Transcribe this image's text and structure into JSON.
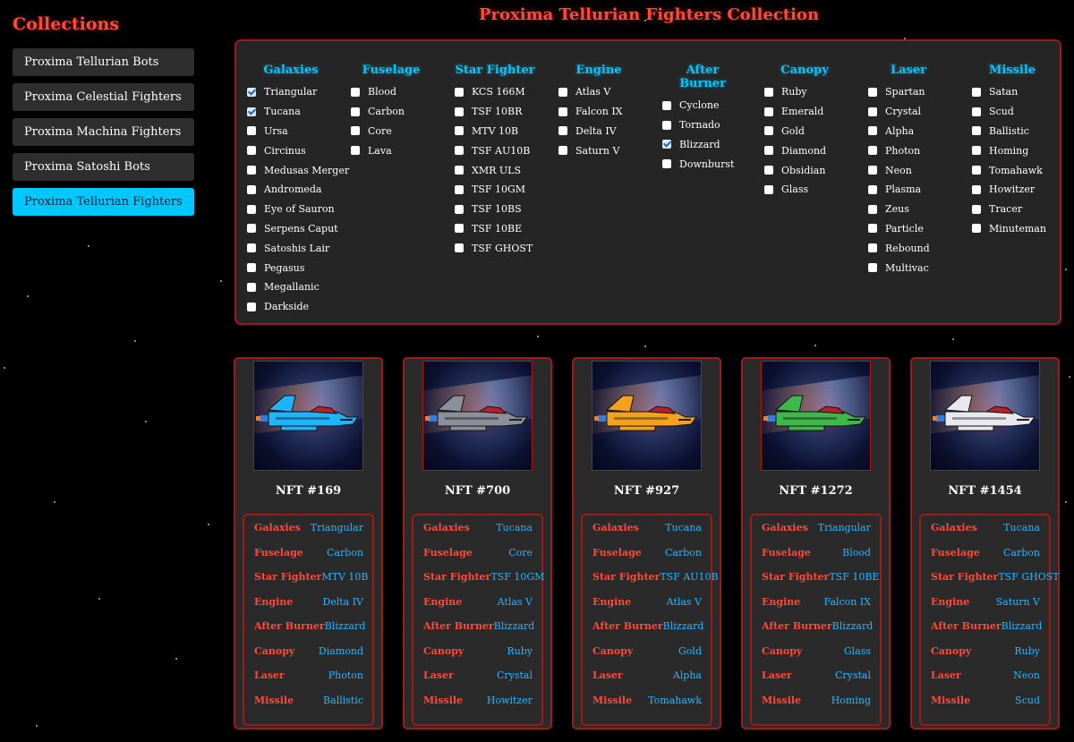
{
  "sidebar": {
    "heading": "Collections",
    "items": [
      {
        "label": "Proxima Tellurian Bots"
      },
      {
        "label": "Proxima Celestial Fighters"
      },
      {
        "label": "Proxima Machina Fighters"
      },
      {
        "label": "Proxima Satoshi Bots"
      },
      {
        "label": "Proxima Tellurian Fighters",
        "active": true
      }
    ]
  },
  "title": "Proxima Tellurian Fighters Collection",
  "filters": [
    {
      "name": "Galaxies",
      "options": [
        {
          "label": "Triangular",
          "checked": true
        },
        {
          "label": "Tucana",
          "checked": true
        },
        {
          "label": "Ursa"
        },
        {
          "label": "Circinus"
        },
        {
          "label": "Medusas Merger"
        },
        {
          "label": "Andromeda"
        },
        {
          "label": "Eye of Sauron"
        },
        {
          "label": "Serpens Caput"
        },
        {
          "label": "Satoshis Lair"
        },
        {
          "label": "Pegasus"
        },
        {
          "label": "Megallanic"
        },
        {
          "label": "Darkside"
        }
      ]
    },
    {
      "name": "Fuselage",
      "options": [
        {
          "label": "Blood"
        },
        {
          "label": "Carbon"
        },
        {
          "label": "Core"
        },
        {
          "label": "Lava"
        }
      ]
    },
    {
      "name": "Star Fighter",
      "options": [
        {
          "label": "KCS 166M"
        },
        {
          "label": "TSF 10BR"
        },
        {
          "label": "MTV 10B"
        },
        {
          "label": "TSF AU10B"
        },
        {
          "label": "XMR ULS"
        },
        {
          "label": "TSF 10GM"
        },
        {
          "label": "TSF 10BS"
        },
        {
          "label": "TSF 10BE"
        },
        {
          "label": "TSF GHOST"
        }
      ]
    },
    {
      "name": "Engine",
      "options": [
        {
          "label": "Atlas V"
        },
        {
          "label": "Falcon IX"
        },
        {
          "label": "Delta IV"
        },
        {
          "label": "Saturn V"
        }
      ]
    },
    {
      "name": "After Burner",
      "options": [
        {
          "label": "Cyclone"
        },
        {
          "label": "Tornado"
        },
        {
          "label": "Blizzard",
          "checked": true
        },
        {
          "label": "Downburst"
        }
      ]
    },
    {
      "name": "Canopy",
      "options": [
        {
          "label": "Ruby"
        },
        {
          "label": "Emerald"
        },
        {
          "label": "Gold"
        },
        {
          "label": "Diamond"
        },
        {
          "label": "Obsidian"
        },
        {
          "label": "Glass"
        }
      ]
    },
    {
      "name": "Laser",
      "options": [
        {
          "label": "Spartan"
        },
        {
          "label": "Crystal"
        },
        {
          "label": "Alpha"
        },
        {
          "label": "Photon"
        },
        {
          "label": "Neon"
        },
        {
          "label": "Plasma"
        },
        {
          "label": "Zeus"
        },
        {
          "label": "Particle"
        },
        {
          "label": "Rebound"
        },
        {
          "label": "Multivac"
        }
      ]
    },
    {
      "name": "Missile",
      "options": [
        {
          "label": "Satan"
        },
        {
          "label": "Scud"
        },
        {
          "label": "Ballistic"
        },
        {
          "label": "Homing"
        },
        {
          "label": "Tomahawk"
        },
        {
          "label": "Howitzer"
        },
        {
          "label": "Tracer"
        },
        {
          "label": "Minuteman"
        }
      ]
    }
  ],
  "cards": [
    {
      "title": "NFT #169",
      "ship_color": "#1fb4ff",
      "traits": [
        {
          "k": "Galaxies",
          "v": "Triangular"
        },
        {
          "k": "Fuselage",
          "v": "Carbon"
        },
        {
          "k": "Star Fighter",
          "v": "MTV 10B"
        },
        {
          "k": "Engine",
          "v": "Delta IV"
        },
        {
          "k": "After Burner",
          "v": "Blizzard"
        },
        {
          "k": "Canopy",
          "v": "Diamond"
        },
        {
          "k": "Laser",
          "v": "Photon"
        },
        {
          "k": "Missile",
          "v": "Ballistic"
        }
      ]
    },
    {
      "title": "NFT #700",
      "ship_color": "#8a8f99",
      "traits": [
        {
          "k": "Galaxies",
          "v": "Tucana"
        },
        {
          "k": "Fuselage",
          "v": "Core"
        },
        {
          "k": "Star Fighter",
          "v": "TSF 10GM"
        },
        {
          "k": "Engine",
          "v": "Atlas V"
        },
        {
          "k": "After Burner",
          "v": "Blizzard"
        },
        {
          "k": "Canopy",
          "v": "Ruby"
        },
        {
          "k": "Laser",
          "v": "Crystal"
        },
        {
          "k": "Missile",
          "v": "Howitzer"
        }
      ]
    },
    {
      "title": "NFT #927",
      "ship_color": "#f4a21c",
      "traits": [
        {
          "k": "Galaxies",
          "v": "Tucana"
        },
        {
          "k": "Fuselage",
          "v": "Carbon"
        },
        {
          "k": "Star Fighter",
          "v": "TSF AU10B"
        },
        {
          "k": "Engine",
          "v": "Atlas V"
        },
        {
          "k": "After Burner",
          "v": "Blizzard"
        },
        {
          "k": "Canopy",
          "v": "Gold"
        },
        {
          "k": "Laser",
          "v": "Alpha"
        },
        {
          "k": "Missile",
          "v": "Tomahawk"
        }
      ]
    },
    {
      "title": "NFT #1272",
      "ship_color": "#3fb84a",
      "traits": [
        {
          "k": "Galaxies",
          "v": "Triangular"
        },
        {
          "k": "Fuselage",
          "v": "Blood"
        },
        {
          "k": "Star Fighter",
          "v": "TSF 10BE"
        },
        {
          "k": "Engine",
          "v": "Falcon IX"
        },
        {
          "k": "After Burner",
          "v": "Blizzard"
        },
        {
          "k": "Canopy",
          "v": "Glass"
        },
        {
          "k": "Laser",
          "v": "Crystal"
        },
        {
          "k": "Missile",
          "v": "Homing"
        }
      ]
    },
    {
      "title": "NFT #1454",
      "ship_color": "#e8e8ee",
      "traits": [
        {
          "k": "Galaxies",
          "v": "Tucana"
        },
        {
          "k": "Fuselage",
          "v": "Carbon"
        },
        {
          "k": "Star Fighter",
          "v": "TSF GHOST"
        },
        {
          "k": "Engine",
          "v": "Saturn V"
        },
        {
          "k": "After Burner",
          "v": "Blizzard"
        },
        {
          "k": "Canopy",
          "v": "Ruby"
        },
        {
          "k": "Laser",
          "v": "Neon"
        },
        {
          "k": "Missile",
          "v": "Scud"
        }
      ]
    }
  ]
}
